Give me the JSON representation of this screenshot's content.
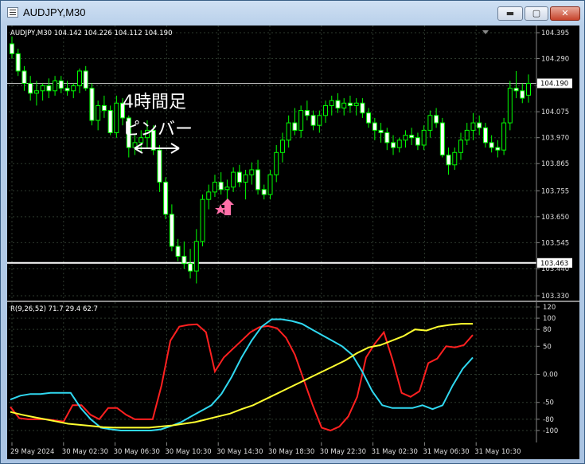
{
  "window": {
    "title": "AUDJPY,M30",
    "controls": {
      "minimize": "▬",
      "maximize": "▢",
      "close": "✕"
    }
  },
  "chart": {
    "header": "AUDJPY,M30  104.142 104.226 104.112 104.190",
    "annotation_line1": "4時間足",
    "annotation_line2": "ピンバー",
    "marker_icon": "pink-up-arrow-with-star",
    "price_labels": [
      "104.395",
      "104.290",
      "104.180",
      "104.075",
      "103.970",
      "103.865",
      "103.755",
      "103.650",
      "103.545",
      "103.440",
      "103.330"
    ],
    "current_price": "104.190",
    "hline_price": "103.463",
    "time_labels": [
      "29 May 2024",
      "30 May 02:30",
      "30 May 06:30",
      "30 May 10:30",
      "30 May 14:30",
      "30 May 18:30",
      "30 May 22:30",
      "31 May 02:30",
      "31 May 06:30",
      "31 May 10:30"
    ],
    "colors": {
      "bull_body": "#000000",
      "bear_body": "#ffffff",
      "wick": "#00ff00",
      "grid": "#2e3a2e",
      "background": "#000000"
    }
  },
  "indicator": {
    "header": "R(9,26,52) 71.7 29.4 62.7",
    "levels": [
      "120",
      "100",
      "80",
      "50",
      "0.00",
      "-50",
      "-80",
      "-100"
    ],
    "colors": {
      "fast": "#ff2020",
      "mid": "#30d8f0",
      "slow": "#ffff30"
    }
  },
  "chart_data": {
    "type": "candlestick",
    "title": "AUDJPY,M30",
    "ylim": [
      103.33,
      104.395
    ],
    "ohlc": [
      {
        "o": 104.35,
        "h": 104.38,
        "l": 104.29,
        "c": 104.31
      },
      {
        "o": 104.31,
        "h": 104.33,
        "l": 104.22,
        "c": 104.24
      },
      {
        "o": 104.24,
        "h": 104.26,
        "l": 104.16,
        "c": 104.19
      },
      {
        "o": 104.19,
        "h": 104.22,
        "l": 104.12,
        "c": 104.15
      },
      {
        "o": 104.15,
        "h": 104.2,
        "l": 104.1,
        "c": 104.16
      },
      {
        "o": 104.16,
        "h": 104.19,
        "l": 104.12,
        "c": 104.18
      },
      {
        "o": 104.18,
        "h": 104.21,
        "l": 104.13,
        "c": 104.16
      },
      {
        "o": 104.16,
        "h": 104.22,
        "l": 104.14,
        "c": 104.2
      },
      {
        "o": 104.2,
        "h": 104.22,
        "l": 104.15,
        "c": 104.17
      },
      {
        "o": 104.17,
        "h": 104.2,
        "l": 104.14,
        "c": 104.16
      },
      {
        "o": 104.16,
        "h": 104.19,
        "l": 104.13,
        "c": 104.18
      },
      {
        "o": 104.18,
        "h": 104.25,
        "l": 104.15,
        "c": 104.24
      },
      {
        "o": 104.24,
        "h": 104.26,
        "l": 104.16,
        "c": 104.17
      },
      {
        "o": 104.17,
        "h": 104.19,
        "l": 104.02,
        "c": 104.04
      },
      {
        "o": 104.04,
        "h": 104.12,
        "l": 104.0,
        "c": 104.1
      },
      {
        "o": 104.1,
        "h": 104.14,
        "l": 104.05,
        "c": 104.08
      },
      {
        "o": 104.08,
        "h": 104.1,
        "l": 103.98,
        "c": 103.99
      },
      {
        "o": 103.99,
        "h": 104.14,
        "l": 103.97,
        "c": 104.11
      },
      {
        "o": 104.11,
        "h": 104.13,
        "l": 104.02,
        "c": 104.05
      },
      {
        "o": 104.05,
        "h": 104.06,
        "l": 103.89,
        "c": 103.93
      },
      {
        "o": 103.93,
        "h": 103.98,
        "l": 103.9,
        "c": 103.95
      },
      {
        "o": 103.95,
        "h": 104.0,
        "l": 103.91,
        "c": 103.97
      },
      {
        "o": 103.97,
        "h": 104.04,
        "l": 103.93,
        "c": 104.0
      },
      {
        "o": 104.0,
        "h": 104.02,
        "l": 103.9,
        "c": 103.92
      },
      {
        "o": 103.92,
        "h": 103.94,
        "l": 103.75,
        "c": 103.79
      },
      {
        "o": 103.79,
        "h": 103.81,
        "l": 103.64,
        "c": 103.66
      },
      {
        "o": 103.66,
        "h": 103.7,
        "l": 103.51,
        "c": 103.53
      },
      {
        "o": 103.53,
        "h": 103.56,
        "l": 103.47,
        "c": 103.49
      },
      {
        "o": 103.49,
        "h": 103.55,
        "l": 103.44,
        "c": 103.46
      },
      {
        "o": 103.46,
        "h": 103.52,
        "l": 103.4,
        "c": 103.43
      },
      {
        "o": 103.43,
        "h": 103.6,
        "l": 103.38,
        "c": 103.55
      },
      {
        "o": 103.55,
        "h": 103.74,
        "l": 103.53,
        "c": 103.72
      },
      {
        "o": 103.72,
        "h": 103.78,
        "l": 103.68,
        "c": 103.75
      },
      {
        "o": 103.75,
        "h": 103.82,
        "l": 103.73,
        "c": 103.79
      },
      {
        "o": 103.79,
        "h": 103.83,
        "l": 103.74,
        "c": 103.76
      },
      {
        "o": 103.76,
        "h": 103.8,
        "l": 103.71,
        "c": 103.77
      },
      {
        "o": 103.77,
        "h": 103.85,
        "l": 103.75,
        "c": 103.83
      },
      {
        "o": 103.83,
        "h": 103.86,
        "l": 103.77,
        "c": 103.79
      },
      {
        "o": 103.79,
        "h": 103.84,
        "l": 103.72,
        "c": 103.82
      },
      {
        "o": 103.82,
        "h": 103.87,
        "l": 103.78,
        "c": 103.84
      },
      {
        "o": 103.84,
        "h": 103.88,
        "l": 103.74,
        "c": 103.76
      },
      {
        "o": 103.76,
        "h": 103.78,
        "l": 103.72,
        "c": 103.74
      },
      {
        "o": 103.74,
        "h": 103.84,
        "l": 103.72,
        "c": 103.82
      },
      {
        "o": 103.82,
        "h": 103.94,
        "l": 103.79,
        "c": 103.91
      },
      {
        "o": 103.91,
        "h": 103.99,
        "l": 103.87,
        "c": 103.96
      },
      {
        "o": 103.96,
        "h": 104.06,
        "l": 103.93,
        "c": 104.03
      },
      {
        "o": 104.03,
        "h": 104.09,
        "l": 103.98,
        "c": 104.0
      },
      {
        "o": 104.0,
        "h": 104.1,
        "l": 103.97,
        "c": 104.08
      },
      {
        "o": 104.08,
        "h": 104.12,
        "l": 104.04,
        "c": 104.06
      },
      {
        "o": 104.06,
        "h": 104.08,
        "l": 104.0,
        "c": 104.02
      },
      {
        "o": 104.02,
        "h": 104.08,
        "l": 103.99,
        "c": 104.06
      },
      {
        "o": 104.06,
        "h": 104.12,
        "l": 104.03,
        "c": 104.1
      },
      {
        "o": 104.1,
        "h": 104.14,
        "l": 104.06,
        "c": 104.12
      },
      {
        "o": 104.12,
        "h": 104.15,
        "l": 104.07,
        "c": 104.09
      },
      {
        "o": 104.09,
        "h": 104.13,
        "l": 104.06,
        "c": 104.11
      },
      {
        "o": 104.11,
        "h": 104.14,
        "l": 104.07,
        "c": 104.1
      },
      {
        "o": 104.1,
        "h": 104.13,
        "l": 104.06,
        "c": 104.11
      },
      {
        "o": 104.11,
        "h": 104.13,
        "l": 104.05,
        "c": 104.07
      },
      {
        "o": 104.07,
        "h": 104.09,
        "l": 104.01,
        "c": 104.03
      },
      {
        "o": 104.03,
        "h": 104.05,
        "l": 103.96,
        "c": 104.0
      },
      {
        "o": 104.0,
        "h": 104.03,
        "l": 103.95,
        "c": 103.99
      },
      {
        "o": 103.99,
        "h": 104.01,
        "l": 103.92,
        "c": 103.95
      },
      {
        "o": 103.95,
        "h": 103.98,
        "l": 103.9,
        "c": 103.93
      },
      {
        "o": 103.93,
        "h": 103.97,
        "l": 103.91,
        "c": 103.96
      },
      {
        "o": 103.96,
        "h": 104.0,
        "l": 103.93,
        "c": 103.98
      },
      {
        "o": 103.98,
        "h": 104.01,
        "l": 103.94,
        "c": 103.97
      },
      {
        "o": 103.97,
        "h": 103.99,
        "l": 103.92,
        "c": 103.94
      },
      {
        "o": 103.94,
        "h": 104.02,
        "l": 103.92,
        "c": 104.0
      },
      {
        "o": 104.0,
        "h": 104.08,
        "l": 103.97,
        "c": 104.06
      },
      {
        "o": 104.06,
        "h": 104.09,
        "l": 104.01,
        "c": 104.03
      },
      {
        "o": 104.03,
        "h": 104.05,
        "l": 103.89,
        "c": 103.9
      },
      {
        "o": 103.9,
        "h": 103.93,
        "l": 103.82,
        "c": 103.86
      },
      {
        "o": 103.86,
        "h": 103.93,
        "l": 103.84,
        "c": 103.91
      },
      {
        "o": 103.91,
        "h": 103.99,
        "l": 103.88,
        "c": 103.96
      },
      {
        "o": 103.96,
        "h": 104.03,
        "l": 103.94,
        "c": 104.0
      },
      {
        "o": 104.0,
        "h": 104.07,
        "l": 103.96,
        "c": 104.03
      },
      {
        "o": 104.03,
        "h": 104.06,
        "l": 103.98,
        "c": 104.01
      },
      {
        "o": 104.01,
        "h": 104.03,
        "l": 103.93,
        "c": 103.95
      },
      {
        "o": 103.95,
        "h": 103.98,
        "l": 103.91,
        "c": 103.93
      },
      {
        "o": 103.93,
        "h": 103.96,
        "l": 103.89,
        "c": 103.92
      },
      {
        "o": 103.92,
        "h": 104.05,
        "l": 103.9,
        "c": 104.03
      },
      {
        "o": 104.03,
        "h": 104.2,
        "l": 104.0,
        "c": 104.17
      },
      {
        "o": 104.17,
        "h": 104.24,
        "l": 104.13,
        "c": 104.16
      },
      {
        "o": 104.16,
        "h": 104.19,
        "l": 104.11,
        "c": 104.13
      },
      {
        "o": 104.142,
        "h": 104.226,
        "l": 104.112,
        "c": 104.19
      }
    ],
    "indicator_series": [
      {
        "name": "R 9",
        "color": "#ff2020",
        "values": [
          -58,
          -78,
          -80,
          -80,
          -80,
          -82,
          -84,
          -55,
          -55,
          -72,
          -80,
          -60,
          -60,
          -72,
          -80,
          -80,
          -80,
          -20,
          60,
          85,
          88,
          89,
          75,
          5,
          30,
          45,
          60,
          75,
          84,
          86,
          82,
          65,
          35,
          -10,
          -55,
          -95,
          -100,
          -93,
          -75,
          -40,
          30,
          55,
          75,
          25,
          -33,
          -40,
          -30,
          20,
          28,
          50,
          48,
          52,
          70
        ]
      },
      {
        "name": "R 26",
        "color": "#30d8f0",
        "values": [
          -45,
          -38,
          -35,
          -35,
          -33,
          -33,
          -33,
          -60,
          -80,
          -95,
          -98,
          -100,
          -100,
          -100,
          -100,
          -98,
          -92,
          -85,
          -75,
          -65,
          -55,
          -35,
          -5,
          30,
          60,
          85,
          98,
          98,
          95,
          90,
          80,
          70,
          60,
          50,
          35,
          5,
          -30,
          -55,
          -60,
          -60,
          -60,
          -55,
          -62,
          -55,
          -20,
          10,
          30
        ]
      },
      {
        "name": "R 52",
        "color": "#ffff30",
        "values": [
          -67,
          -72,
          -76,
          -80,
          -84,
          -88,
          -90,
          -92,
          -94,
          -95,
          -95,
          -95,
          -95,
          -93,
          -91,
          -88,
          -85,
          -80,
          -75,
          -70,
          -62,
          -55,
          -45,
          -35,
          -25,
          -15,
          -5,
          5,
          15,
          25,
          38,
          48,
          52,
          60,
          68,
          80,
          78,
          85,
          88,
          90,
          90
        ]
      }
    ]
  }
}
